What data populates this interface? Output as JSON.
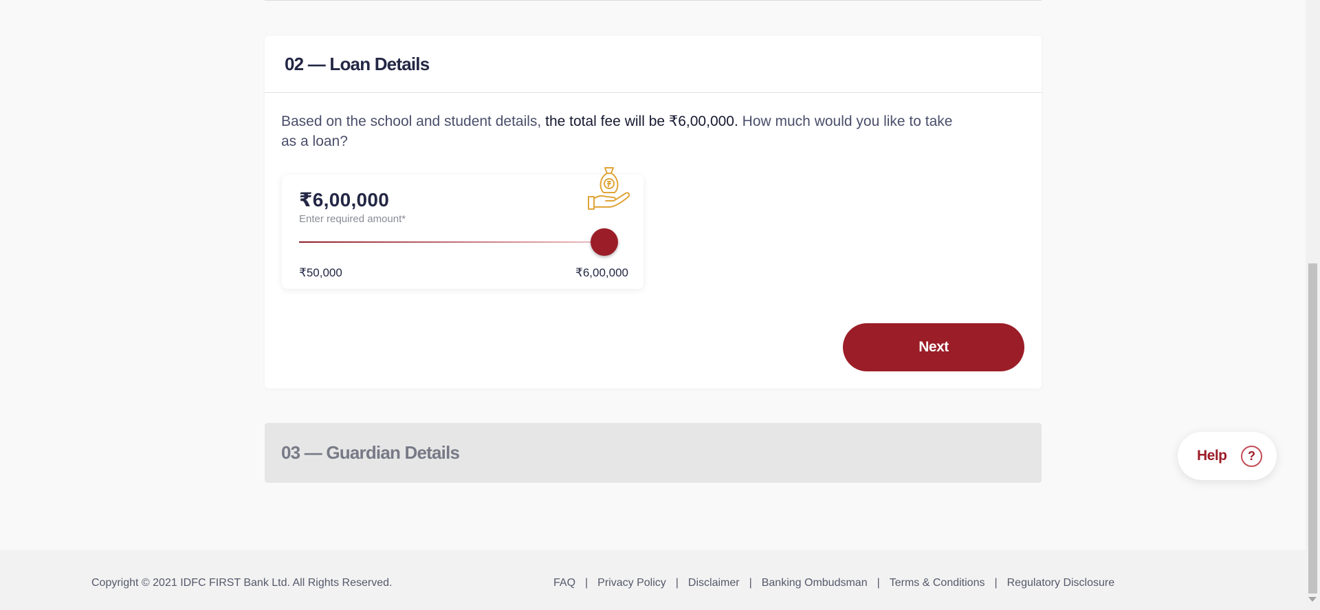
{
  "loan_details": {
    "title": "02 — Loan Details",
    "description_before": "Based on the school and student details, ",
    "description_bold": "the total fee will be ₹6,00,000.",
    "description_after": " How much would you like to take as a loan?",
    "amount_value": "₹6,00,000",
    "amount_hint": "Enter required amount*",
    "slider": {
      "min_label": "₹50,000",
      "max_label": "₹6,00,000",
      "level": 1.0
    },
    "money_icon": "money-bag-in-hand-icon",
    "next_label": "Next"
  },
  "guardian_details": {
    "title": "03 — Guardian Details"
  },
  "help": {
    "label": "Help",
    "icon_glyph": "?"
  },
  "footer": {
    "copyright": "Copyright © 2021 IDFC FIRST Bank Ltd. All Rights Reserved.",
    "links": [
      "FAQ",
      "Privacy Policy",
      "Disclaimer",
      "Banking Ombudsman",
      "Terms & Conditions",
      "Regulatory Disclosure"
    ]
  },
  "colors": {
    "brand": "#9b1d27",
    "icon_gold": "#e0a437"
  }
}
